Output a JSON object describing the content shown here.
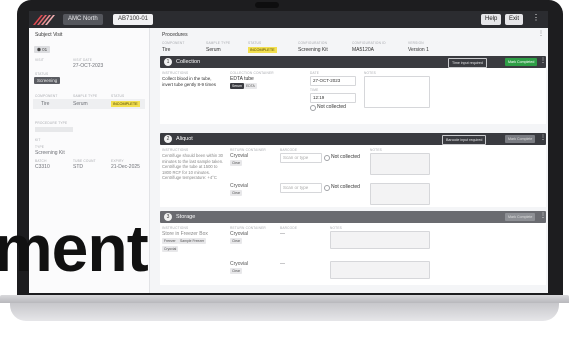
{
  "topbar": {
    "site": "AMC North",
    "subject_id": "AB7100-01",
    "help": "Help",
    "exit": "Exit"
  },
  "left_panel": {
    "title": "Subject Visit",
    "chip_1": "⬢ 01",
    "labels": [
      "VISIT",
      "VISIT DATE",
      "STATUS",
      "COMPONENT",
      "SAMPLE TYPE",
      "STATUS",
      "PROCEDURE TYPE",
      "KIT",
      "TYPE",
      "BATCH",
      "TUBE COUNT",
      "EXPIRY"
    ],
    "visit": "",
    "visit_date": "27-OCT-2023",
    "status_chip": "Screening",
    "component": "Tire",
    "sample_type": "Serum",
    "status": "INCOMPLETE",
    "kit": "Screening Kit",
    "batch": "C3310",
    "tube_count": "STD",
    "expiry": "21-Dec-2025"
  },
  "procedures": {
    "title": "Procedures",
    "headers": [
      "COMPONENT",
      "SAMPLE TYPE",
      "STATUS",
      "CONFIGURATION",
      "CONFIGURATION ID",
      "VERSION"
    ],
    "row": [
      "Tire",
      "Serum",
      "INCOMPLETE",
      "Screening Kit",
      "MA5120A",
      "Version 1"
    ]
  },
  "collection": {
    "num": "1",
    "title": "Collection",
    "btn_time": "Time input required",
    "btn_done": "Mark Completed",
    "labels": [
      "INSTRUCTIONS",
      "COLLECTION CONTAINER",
      "DATE",
      "NOTES",
      "TIME"
    ],
    "instructions": "Collect blood in the tube, invert tube gently 8-9 times",
    "container": "EDTA tube",
    "tag_1": "Serum",
    "tag_2": "EDTA",
    "date": "27-OCT-2023",
    "time": "12:19",
    "not_collected": "Not collected"
  },
  "aliquot": {
    "num": "2",
    "title": "Aliquot",
    "btn_barcode": "Barcode input required",
    "btn_done": "Mark Complete",
    "labels": [
      "INSTRUCTIONS",
      "RETURN CONTAINER",
      "BARCODE",
      "NOTES"
    ],
    "instructions": "Centrifuge should been within 30 minutes to the last sample taken. Centrifuge the tube at 1500 to 1800 RCF for 10 minutes. Centrifuge temperature: +4°C",
    "container_1": "Cryovial",
    "container_2": "Cryovial",
    "tag": "Clear",
    "scan_placeholder": "Scan or type",
    "not_collected": "Not collected"
  },
  "storage": {
    "num": "3",
    "title": "Storage",
    "btn_done": "Mark Complete",
    "labels": [
      "INSTRUCTIONS",
      "RETURN CONTAINER",
      "BARCODE",
      "NOTES"
    ],
    "instructions": "Store in Freezer Box",
    "tags": [
      "Freezer",
      "Sample Freezer",
      "Cryovial"
    ],
    "container_1": "Cryovial",
    "container_2": "Cryovial",
    "tag": "Clear",
    "barcode_1": "—",
    "barcode_2": "—"
  },
  "headline": "ment",
  "colors": {
    "accent": "#2e9e46",
    "highlight": "#f2df4f",
    "dark": "#2b2c30",
    "logo": "#e0484f"
  }
}
